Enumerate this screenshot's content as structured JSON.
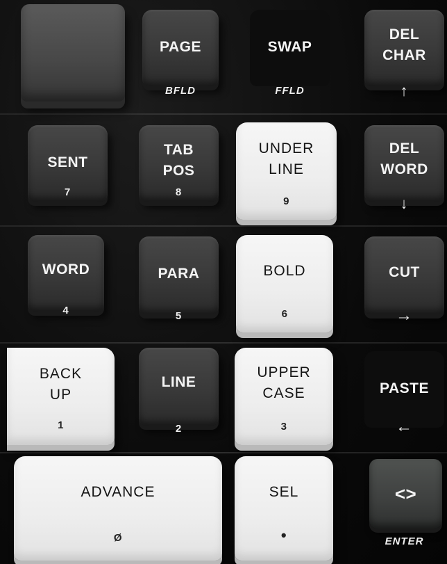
{
  "keys": {
    "page": {
      "label": "PAGE",
      "legend": "BFLD"
    },
    "swap": {
      "label": "SWAP",
      "legend": "FFLD"
    },
    "del_char": {
      "line1": "DEL",
      "line2": "CHAR",
      "legend": "↑"
    },
    "sent": {
      "label": "SENT",
      "legend": "7"
    },
    "tab_pos": {
      "line1": "TAB",
      "line2": "POS",
      "legend": "8"
    },
    "under_line": {
      "line1": "UNDER",
      "line2": "LINE",
      "legend": "9"
    },
    "del_word": {
      "line1": "DEL",
      "line2": "WORD",
      "legend": "↓"
    },
    "word": {
      "label": "WORD",
      "legend": "4"
    },
    "para": {
      "label": "PARA",
      "legend": "5"
    },
    "bold": {
      "label": "BOLD",
      "legend": "6"
    },
    "cut": {
      "label": "CUT",
      "legend": "→"
    },
    "back_up": {
      "line1": "BACK",
      "line2": "UP",
      "legend": "1"
    },
    "line": {
      "label": "LINE",
      "legend": "2"
    },
    "upper_case": {
      "line1": "UPPER",
      "line2": "CASE",
      "legend": "3"
    },
    "paste": {
      "label": "PASTE",
      "legend": "←"
    },
    "advance": {
      "label": "ADVANCE",
      "legend": "Ø"
    },
    "sel": {
      "label": "SEL",
      "legend": "•"
    },
    "enter": {
      "label": "<>",
      "legend": "ENTER"
    }
  },
  "colors": {
    "dark_key": "#3f3f3f",
    "light_key": "#efefef",
    "background": "#0b0b0b"
  }
}
